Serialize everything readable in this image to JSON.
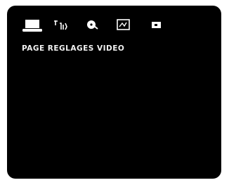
{
  "screen": {
    "icons": [
      {
        "name": "display-icon",
        "selected": true
      },
      {
        "name": "audio-icon",
        "selected": false
      },
      {
        "name": "disc-icon",
        "selected": false
      },
      {
        "name": "image-settings-icon",
        "selected": false
      },
      {
        "name": "preferences-icon",
        "selected": false
      }
    ],
    "page_label": "PAGE REGLAGES VIDEO"
  }
}
